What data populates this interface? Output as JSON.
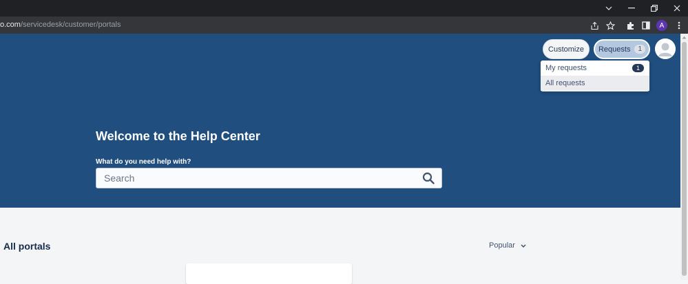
{
  "browser": {
    "url_host": "o.com",
    "url_path": "/servicedesk/customer/portals",
    "profile_initial": "A"
  },
  "header": {
    "customize_label": "Customize",
    "requests_label": "Requests",
    "requests_count": "1"
  },
  "requests_menu": {
    "items": [
      {
        "label": "My requests",
        "badge": "1"
      },
      {
        "label": "All requests"
      }
    ]
  },
  "hero": {
    "title": "Welcome to the Help Center",
    "search_label": "What do you need help with?",
    "search_placeholder": "Search"
  },
  "portals": {
    "title": "All portals",
    "sort_label": "Popular"
  },
  "colors": {
    "hero_bg": "#1f4e7f",
    "accent": "#253858"
  }
}
